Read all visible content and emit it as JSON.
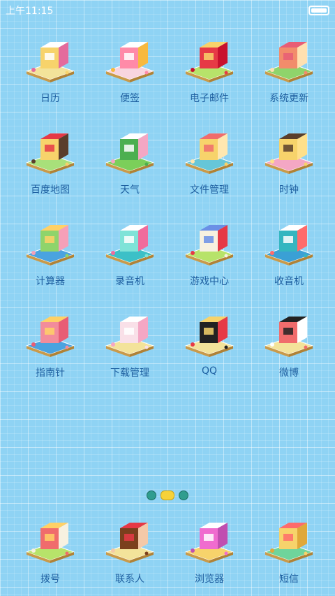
{
  "status": {
    "time": "上午11:15",
    "battery_percent": 100
  },
  "apps": [
    {
      "label": "日历",
      "icon": "calendar-icon"
    },
    {
      "label": "便签",
      "icon": "notes-icon"
    },
    {
      "label": "电子邮件",
      "icon": "mailbox-icon"
    },
    {
      "label": "系统更新",
      "icon": "mushroom-house-icon"
    },
    {
      "label": "百度地图",
      "icon": "map-pin-icon"
    },
    {
      "label": "天气",
      "icon": "weather-hill-icon"
    },
    {
      "label": "文件管理",
      "icon": "file-box-icon"
    },
    {
      "label": "时钟",
      "icon": "clock-icon"
    },
    {
      "label": "计算器",
      "icon": "calculator-icon"
    },
    {
      "label": "录音机",
      "icon": "recorder-icon"
    },
    {
      "label": "游戏中心",
      "icon": "castle-icon"
    },
    {
      "label": "收音机",
      "icon": "radio-icon"
    },
    {
      "label": "指南针",
      "icon": "compass-bird-icon"
    },
    {
      "label": "下载管理",
      "icon": "bunny-icon"
    },
    {
      "label": "QQ",
      "icon": "penguin-icon"
    },
    {
      "label": "微博",
      "icon": "weibo-eye-icon"
    }
  ],
  "pager": {
    "pages": 3,
    "active": 1
  },
  "dock": [
    {
      "label": "拨号",
      "icon": "phone-icon"
    },
    {
      "label": "联系人",
      "icon": "contact-girl-icon"
    },
    {
      "label": "浏览器",
      "icon": "browser-icon"
    },
    {
      "label": "短信",
      "icon": "message-icon"
    }
  ]
}
